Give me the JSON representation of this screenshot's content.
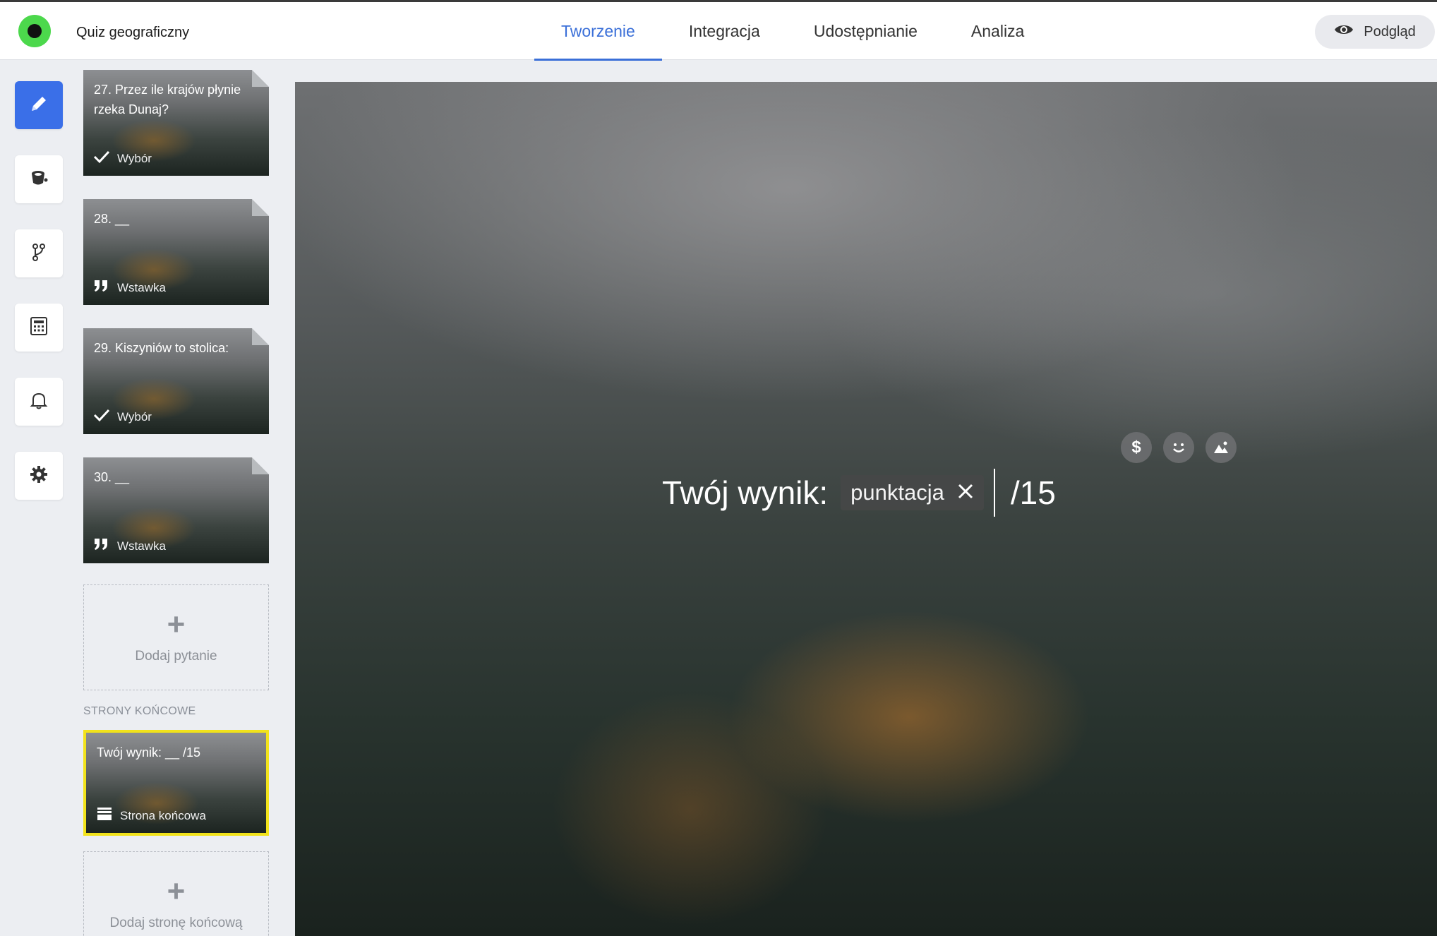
{
  "app": {
    "title": "Quiz geograficzny"
  },
  "tabs": [
    {
      "label": "Tworzenie",
      "active": true
    },
    {
      "label": "Integracja",
      "active": false
    },
    {
      "label": "Udostępnianie",
      "active": false
    },
    {
      "label": "Analiza",
      "active": false
    }
  ],
  "preview": {
    "label": "Podgląd",
    "icon": "eye-icon"
  },
  "rail": [
    {
      "icon": "pencil-icon",
      "active": true
    },
    {
      "icon": "paint-bucket-icon",
      "active": false
    },
    {
      "icon": "branch-icon",
      "active": false
    },
    {
      "icon": "calculator-icon",
      "active": false
    },
    {
      "icon": "bell-icon",
      "active": false
    },
    {
      "icon": "gear-icon",
      "active": false
    }
  ],
  "slides": [
    {
      "title": "27. Przez ile krajów płynie rzeka Dunaj?",
      "type": "Wybór",
      "type_icon": "check-icon"
    },
    {
      "title": "28. __",
      "type": "Wstawka",
      "type_icon": "quote-icon"
    },
    {
      "title": "29. Kiszyniów to stolica:",
      "type": "Wybór",
      "type_icon": "check-icon"
    },
    {
      "title": "30. __",
      "type": "Wstawka",
      "type_icon": "quote-icon"
    }
  ],
  "add_question": {
    "label": "Dodaj pytanie"
  },
  "end_section": {
    "label": "STRONY KOŃCOWE"
  },
  "end_slide": {
    "title": "Twój wynik: __ /15",
    "type": "Strona końcowa",
    "type_icon": "stack-icon",
    "selected_color": "#f2e31b"
  },
  "add_end_page": {
    "label": "Dodaj stronę końcową"
  },
  "editor": {
    "score_label": "Twój wynik:",
    "score_tag": "punktacja",
    "score_max": "/15",
    "tools": [
      "dollar-icon",
      "smiley-icon",
      "image-icon"
    ]
  },
  "colors": {
    "accent": "#3a6fd8",
    "rail_active": "#3a6fe8",
    "logo": "#4cd84c"
  }
}
